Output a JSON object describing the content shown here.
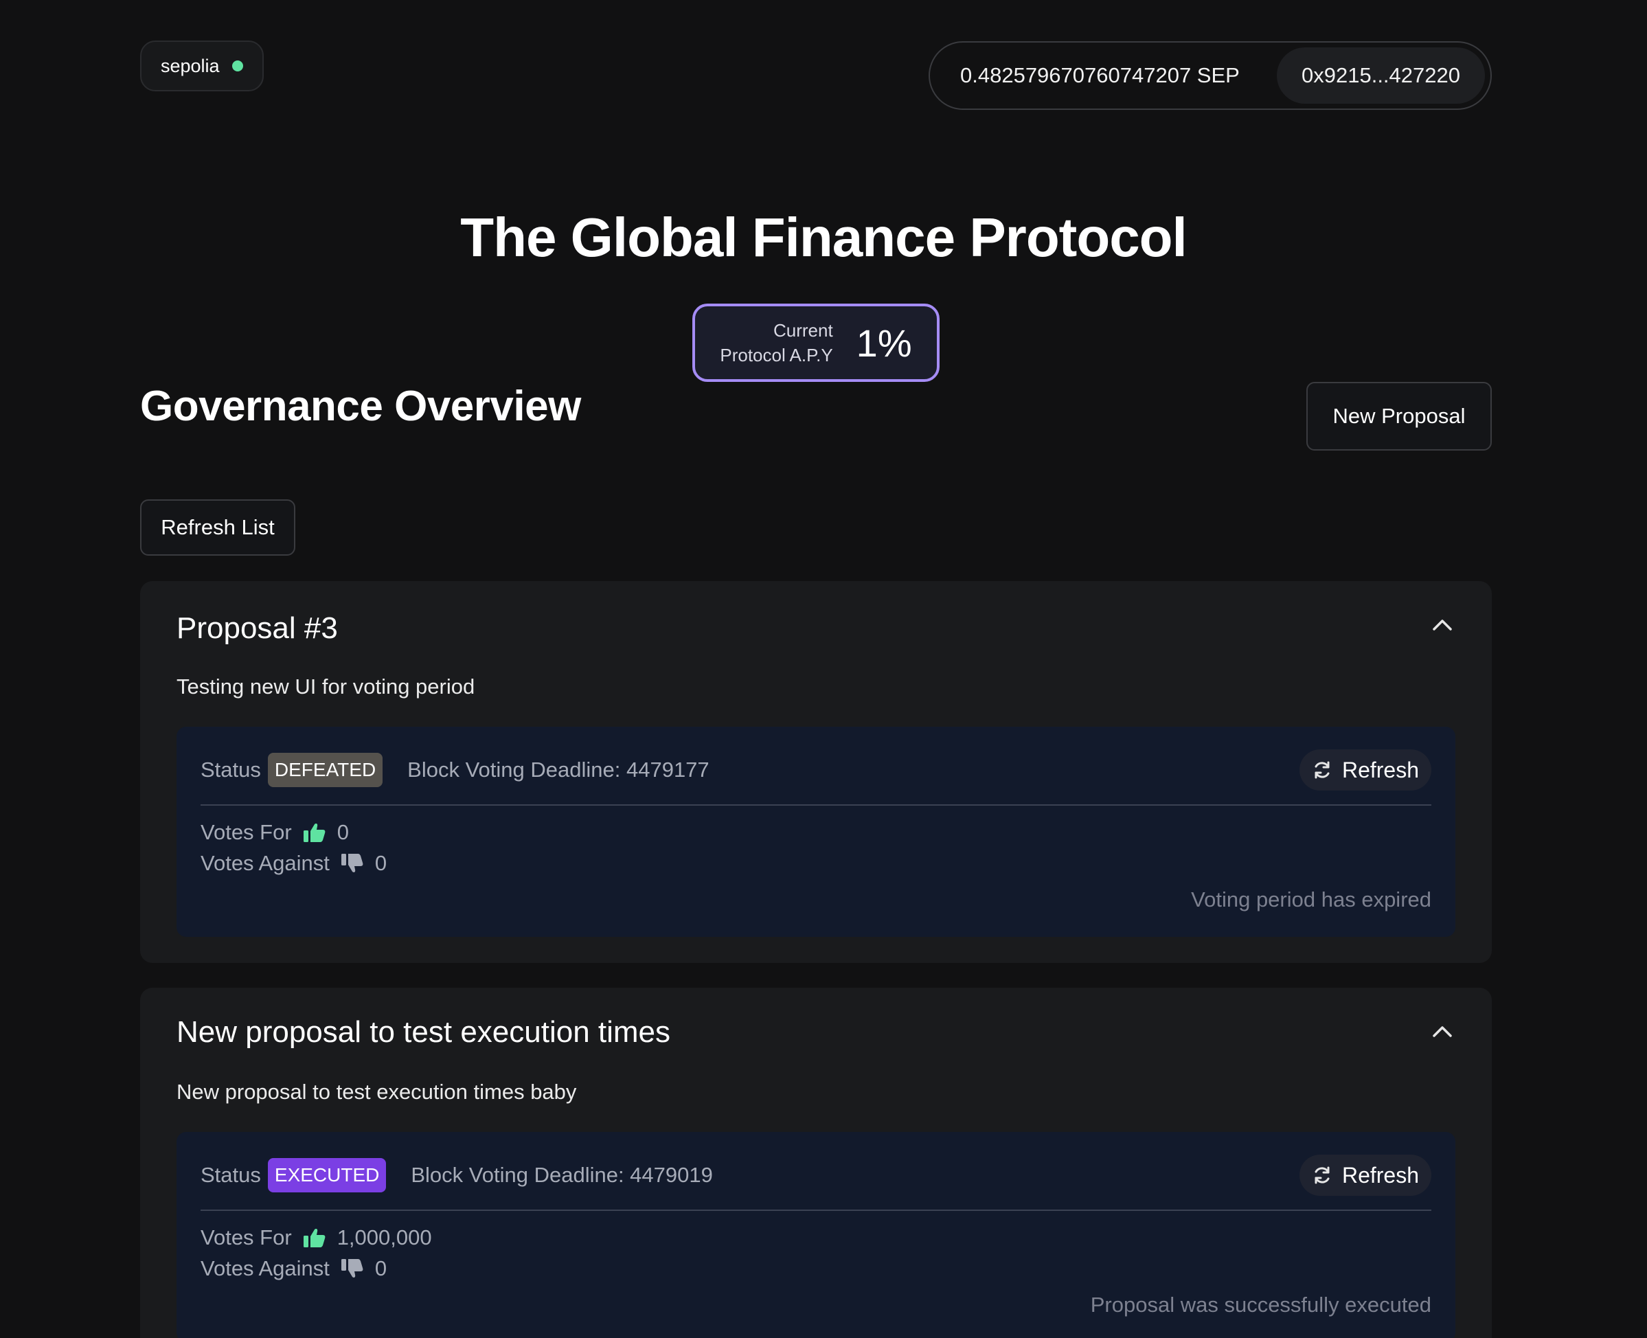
{
  "header": {
    "network": "sepolia",
    "balance": "0.482579670760747207 SEP",
    "address": "0x9215...427220"
  },
  "hero": {
    "title": "The Global Finance Protocol",
    "apy_label_line1": "Current",
    "apy_label_line2": "Protocol A.P.Y",
    "apy_value": "1%"
  },
  "governance": {
    "title": "Governance Overview",
    "new_proposal_label": "New Proposal",
    "refresh_list_label": "Refresh List"
  },
  "labels": {
    "status": "Status",
    "votes_for": "Votes For",
    "votes_against": "Votes Against",
    "refresh": "Refresh"
  },
  "proposals": [
    {
      "title": "Proposal #3",
      "description": "Testing new UI for voting period",
      "status": "DEFEATED",
      "deadline": "Block Voting Deadline: 4479177",
      "votes_for": "0",
      "votes_against": "0",
      "note": "Voting period has expired"
    },
    {
      "title": "New proposal to test execution times",
      "description": "New proposal to test execution times baby",
      "status": "EXECUTED",
      "deadline": "Block Voting Deadline: 4479019",
      "votes_for": "1,000,000",
      "votes_against": "0",
      "note": "Proposal was successfully executed"
    }
  ],
  "colors": {
    "background": "#111112",
    "accent_purple": "#a58cf5",
    "executed_badge": "#7b3fe4",
    "defeated_badge": "#55524d",
    "network_dot": "#5fe3a1",
    "thumb_up": "#5fe3a1",
    "thumb_down": "#a7acb8"
  }
}
